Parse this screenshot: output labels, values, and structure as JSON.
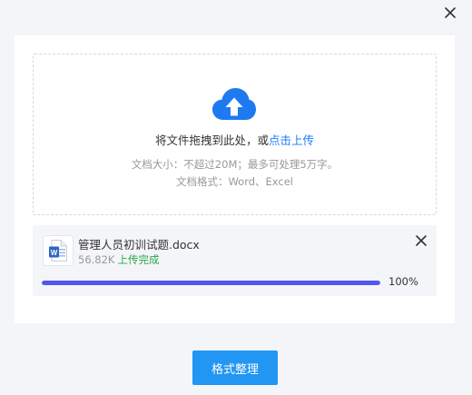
{
  "dialog": {
    "close_icon": "close-icon"
  },
  "dropzone": {
    "icon": "cloud-upload-icon",
    "instruction": "将文件拖拽到此处，或",
    "link_label": "点击上传",
    "size_hint": "文档大小：不超过20M；最多可处理5万字。",
    "format_hint": "文档格式：Word、Excel"
  },
  "file": {
    "icon": "word-document-icon",
    "name": "管理人员初训试题.docx",
    "size": "56.82K",
    "status": "上传完成",
    "progress": 1,
    "progress_label": "100%",
    "remove_icon": "close-icon"
  },
  "actions": {
    "format_button_label": "格式整理"
  },
  "colors": {
    "accent_link": "#1a7cff",
    "cloud_icon": "#1f7af2",
    "success": "#2aa84a",
    "progress_fill": "#5157ee",
    "primary_button": "#2196f3",
    "background": "#f4f5f9"
  }
}
